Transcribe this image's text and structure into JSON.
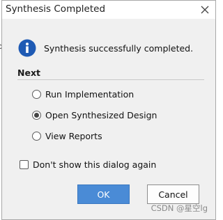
{
  "dialog": {
    "title": "Synthesis Completed",
    "message": "Synthesis successfully completed.",
    "section_label": "Next",
    "options": [
      {
        "label": "Run Implementation",
        "selected": false
      },
      {
        "label": "Open Synthesized Design",
        "selected": true
      },
      {
        "label": "View Reports",
        "selected": false
      }
    ],
    "dont_show_label": "Don't show this dialog again",
    "dont_show_checked": false,
    "ok_label": "OK",
    "cancel_label": "Cancel"
  },
  "watermark": "CSDN @星空lg",
  "colors": {
    "ok_button": "#4a8bd6",
    "info_icon": "#1e5ab4"
  }
}
